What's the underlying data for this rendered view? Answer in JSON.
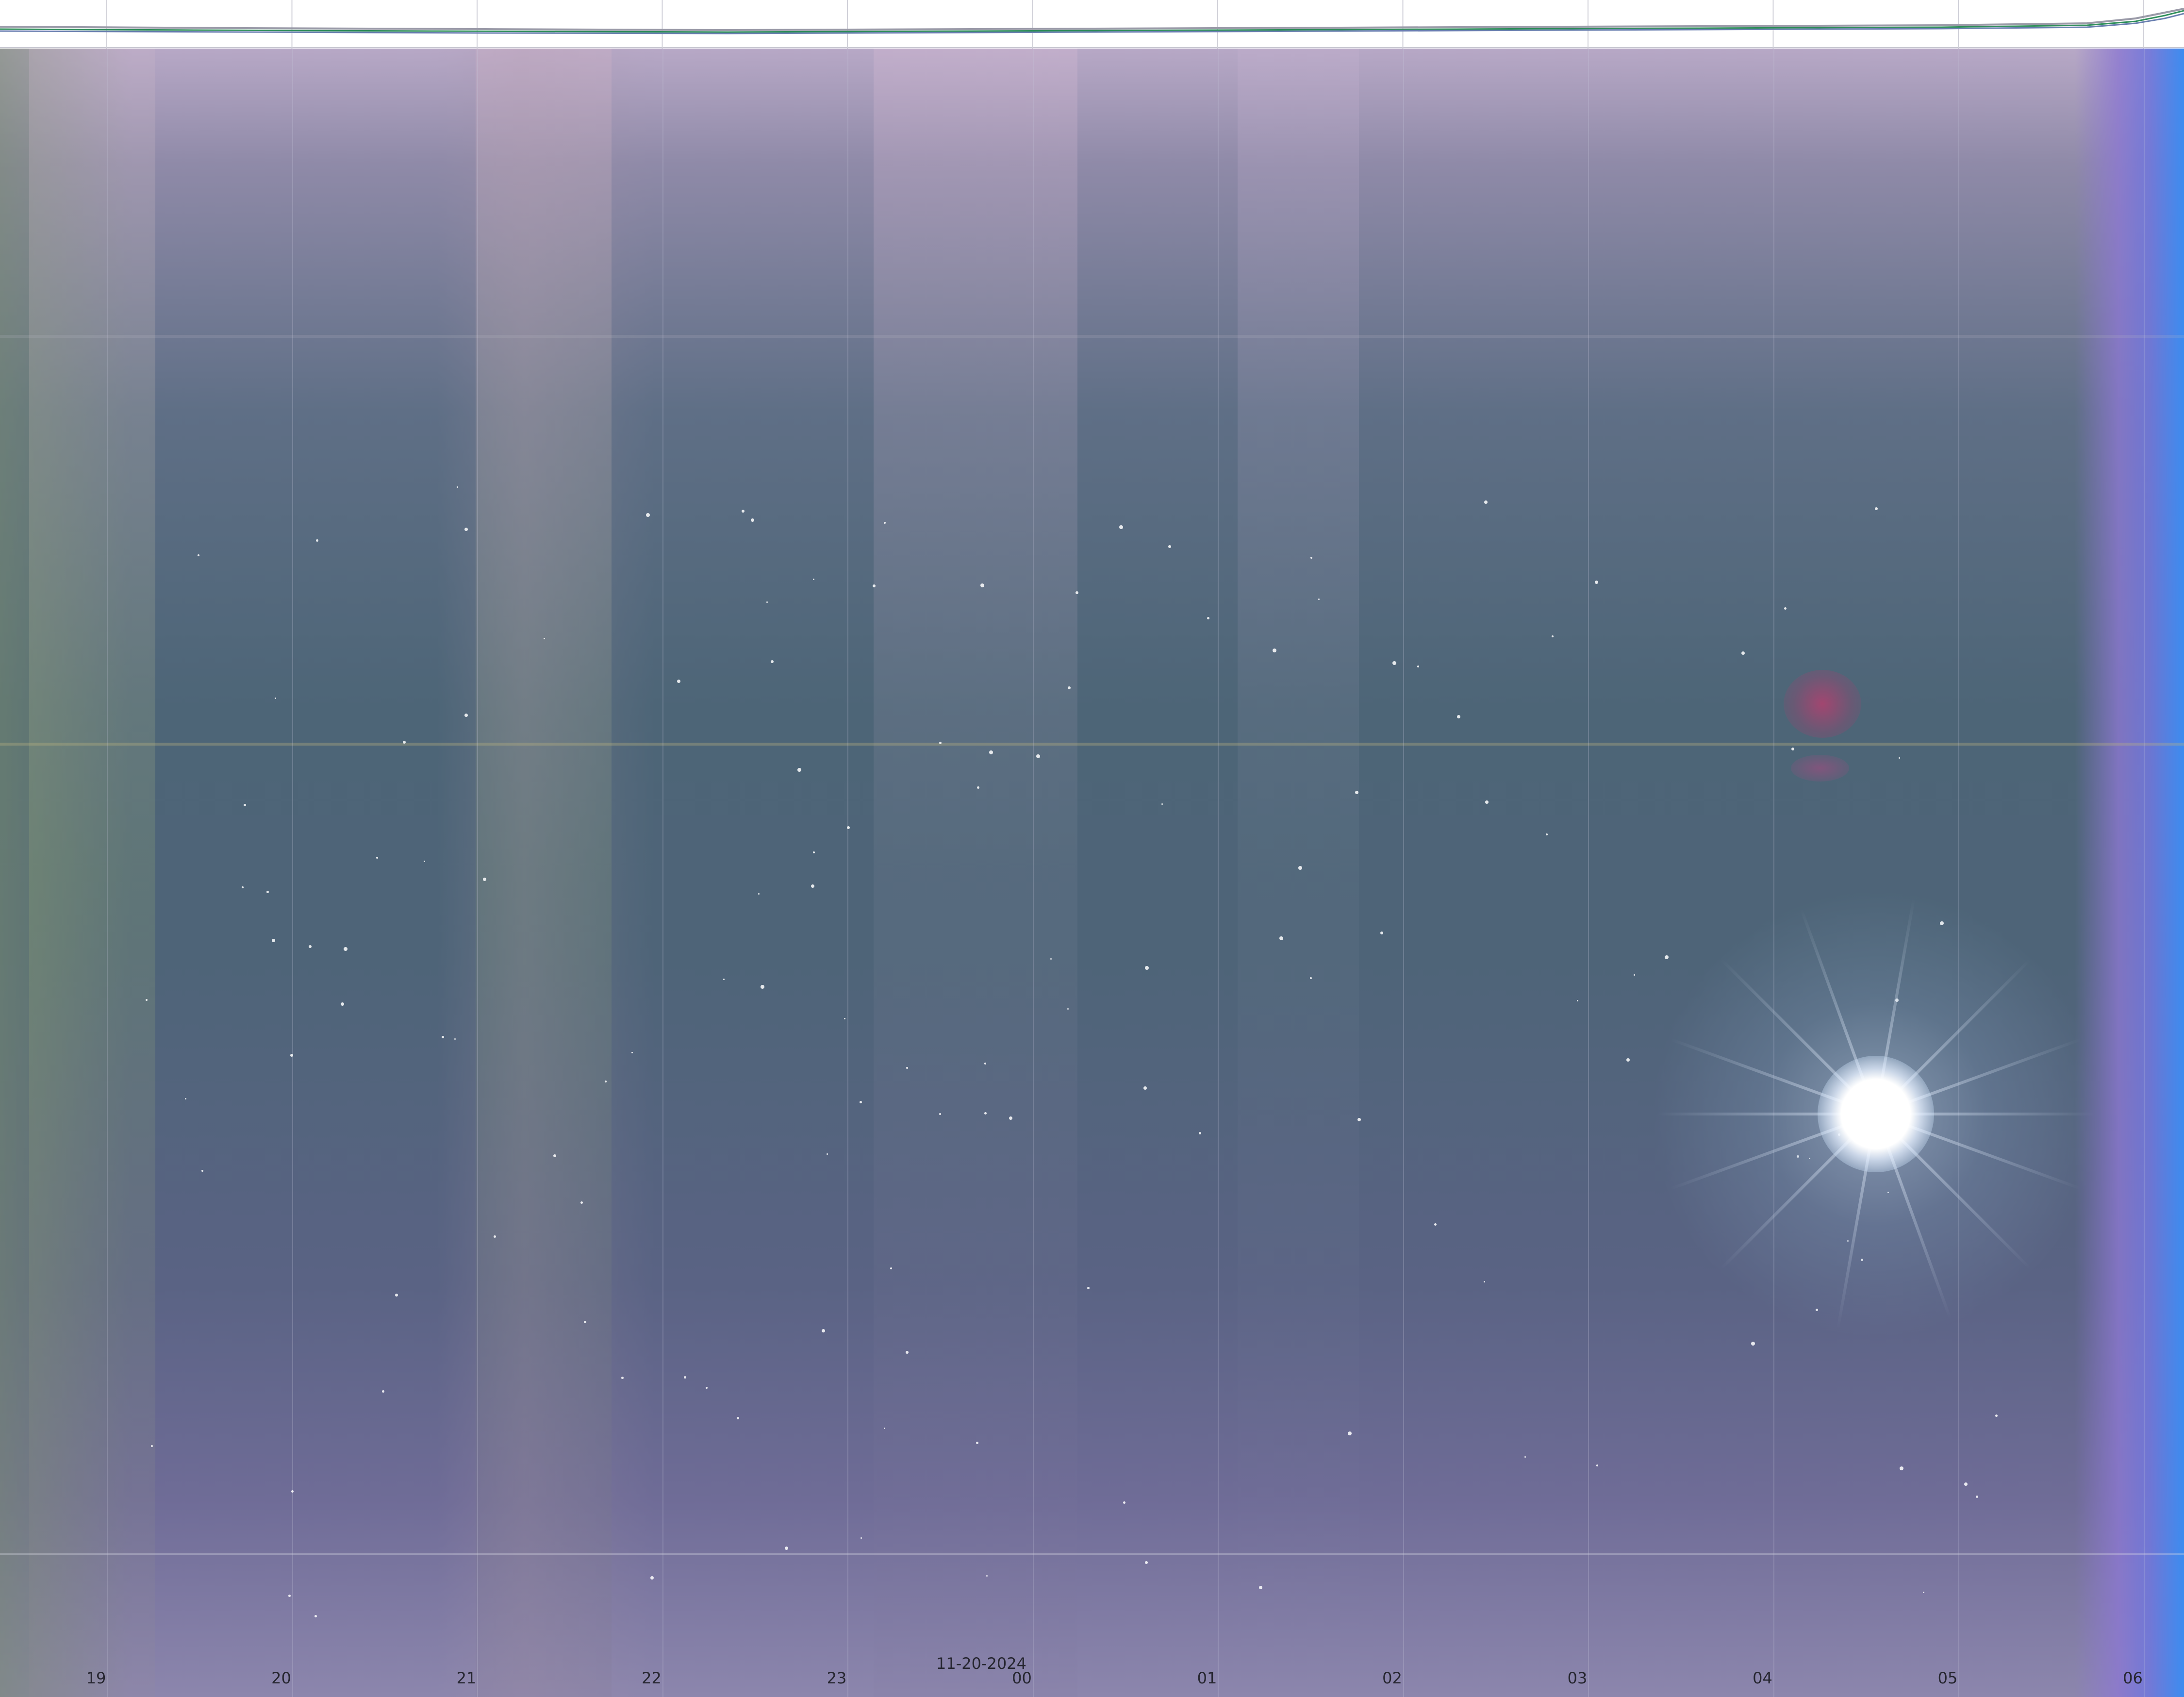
{
  "date_label": "11-20-2024",
  "hour_labels": [
    "19",
    "20",
    "21",
    "22",
    "23",
    "00",
    "01",
    "02",
    "03",
    "04",
    "05",
    "06"
  ],
  "colors": {
    "trace_green": "#2f8f5a",
    "trace_gray": "#9a9aa8",
    "trace_blue": "#6a7fb0",
    "label_text": "#262630"
  }
}
